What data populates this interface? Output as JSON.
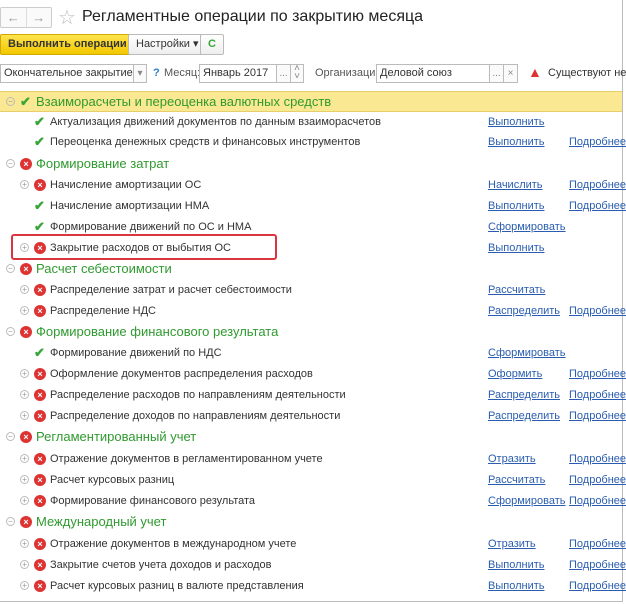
{
  "header": {
    "back": "←",
    "forward": "→",
    "title": "Регламентные операции по закрытию месяца"
  },
  "toolbar": {
    "run": "Выполнить операции",
    "settings": "Настройки ▾",
    "refresh": "C"
  },
  "filters": {
    "mode": "Окончательное закрытие",
    "help": "?",
    "month_label": "Месяц:",
    "month": "Январь 2017",
    "org_label": "Организации:",
    "org": "Деловой союз",
    "warning": "Существуют невы",
    "ellipsis": "...",
    "clear": "×",
    "dropdown": "▾"
  },
  "colors": {
    "ok": "#3aa53a",
    "error": "#dd3333",
    "link": "#2a5db0",
    "group": "#2f9a2f",
    "highlight": "#fbe892"
  },
  "rows": [
    {
      "type": "group",
      "status": "ok",
      "text": "Взаиморасчеты и переоценка валютных средств",
      "highlight": true
    },
    {
      "type": "item",
      "status": "ok",
      "text": "Актуализация движений документов по данным взаиморасчетов",
      "action": "Выполнить"
    },
    {
      "type": "item",
      "status": "ok",
      "text": "Переоценка денежных средств и финансовых инструментов",
      "action": "Выполнить",
      "more": "Подробнее"
    },
    {
      "type": "group",
      "status": "error",
      "text": "Формирование затрат"
    },
    {
      "type": "item",
      "status": "error",
      "expand": true,
      "text": "Начисление амортизации ОС",
      "action": "Начислить",
      "more": "Подробнее"
    },
    {
      "type": "item",
      "status": "ok",
      "text": "Начисление амортизации НМА",
      "action": "Выполнить",
      "more": "Подробнее"
    },
    {
      "type": "item",
      "status": "ok",
      "text": "Формирование движений по ОС и НМА",
      "action": "Сформировать"
    },
    {
      "type": "item",
      "status": "error",
      "expand": true,
      "text": "Закрытие расходов от выбытия ОС",
      "action": "Выполнить"
    },
    {
      "type": "group",
      "status": "error",
      "text": "Расчет себестоимости"
    },
    {
      "type": "item",
      "status": "error",
      "expand": true,
      "text": "Распределение затрат и расчет себестоимости",
      "action": "Рассчитать"
    },
    {
      "type": "item",
      "status": "error",
      "expand": true,
      "text": "Распределение НДС",
      "action": "Распределить",
      "more": "Подробнее"
    },
    {
      "type": "group",
      "status": "error",
      "text": "Формирование финансового результата"
    },
    {
      "type": "item",
      "status": "ok",
      "text": "Формирование движений по НДС",
      "action": "Сформировать"
    },
    {
      "type": "item",
      "status": "error",
      "expand": true,
      "text": "Оформление документов распределения расходов",
      "action": "Оформить",
      "more": "Подробнее"
    },
    {
      "type": "item",
      "status": "error",
      "expand": true,
      "text": "Распределение расходов по направлениям деятельности",
      "action": "Распределить",
      "more": "Подробнее"
    },
    {
      "type": "item",
      "status": "error",
      "expand": true,
      "text": "Распределение доходов по направлениям деятельности",
      "action": "Распределить",
      "more": "Подробнее"
    },
    {
      "type": "group",
      "status": "error",
      "text": "Регламентированный учет"
    },
    {
      "type": "item",
      "status": "error",
      "expand": true,
      "text": "Отражение документов в регламентированном учете",
      "action": "Отразить",
      "more": "Подробнее"
    },
    {
      "type": "item",
      "status": "error",
      "expand": true,
      "text": "Расчет курсовых разниц",
      "action": "Рассчитать",
      "more": "Подробнее"
    },
    {
      "type": "item",
      "status": "error",
      "expand": true,
      "text": "Формирование финансового результата",
      "action": "Сформировать",
      "more": "Подробнее"
    },
    {
      "type": "group",
      "status": "error",
      "text": "Международный учет"
    },
    {
      "type": "item",
      "status": "error",
      "expand": true,
      "text": "Отражение документов в международном учете",
      "action": "Отразить",
      "more": "Подробнее"
    },
    {
      "type": "item",
      "status": "error",
      "expand": true,
      "text": "Закрытие счетов учета доходов и расходов",
      "action": "Выполнить",
      "more": "Подробнее"
    },
    {
      "type": "item",
      "status": "error",
      "expand": true,
      "text": "Расчет курсовых разниц в валюте представления",
      "action": "Выполнить",
      "more": "Подробнее"
    }
  ]
}
